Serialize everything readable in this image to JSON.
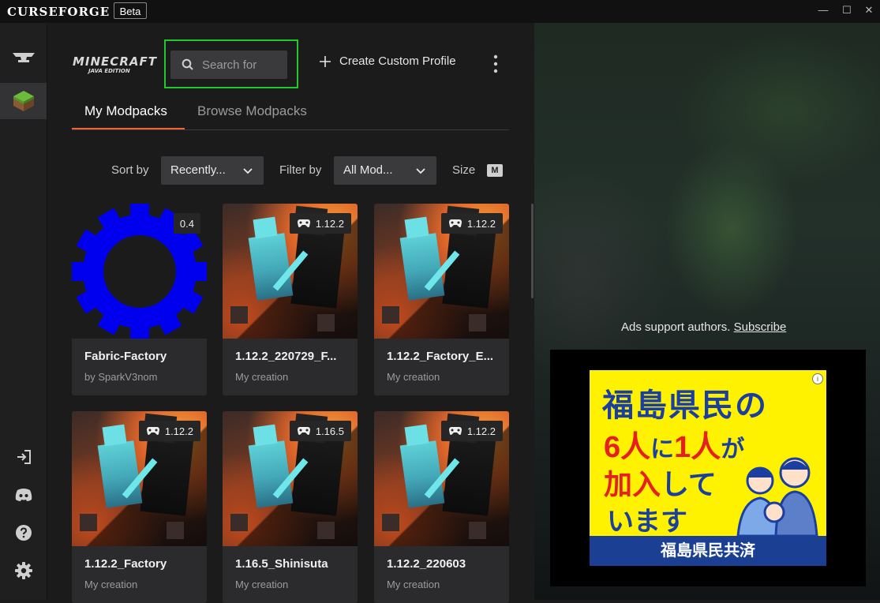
{
  "app": {
    "logo": "CURSEFORGE",
    "beta_label": "Beta"
  },
  "window": {
    "minimize": "—",
    "maximize": "☐",
    "close": "✕"
  },
  "rail": {
    "anvil": "anvil-icon",
    "minecraft": "minecraft-grass-icon",
    "login": "login-icon",
    "discord": "discord-icon",
    "help": "help-icon",
    "settings": "gear-icon"
  },
  "header": {
    "game_logo_line1": "MINECRAFT",
    "game_logo_line2": "JAVA EDITION",
    "search_placeholder": "Search for",
    "create_profile": "Create Custom Profile"
  },
  "tabs": [
    {
      "label": "My Modpacks",
      "active": true
    },
    {
      "label": "Browse Modpacks",
      "active": false
    }
  ],
  "filters": {
    "sort_label": "Sort by",
    "sort_value": "Recently...",
    "filter_label": "Filter by",
    "filter_value": "All Mod...",
    "size_label": "Size",
    "size_value": "M"
  },
  "modpacks": [
    {
      "name": "Fabric-Factory",
      "author": "by SparkV3nom",
      "badge": "0.4",
      "art": "blue-gear"
    },
    {
      "name": "1.12.2_220729_F...",
      "author": "My creation",
      "badge": "1.12.2",
      "art": "minecraft"
    },
    {
      "name": "1.12.2_Factory_E...",
      "author": "My creation",
      "badge": "1.12.2",
      "art": "minecraft"
    },
    {
      "name": "1.12.2_Factory",
      "author": "My creation",
      "badge": "1.12.2",
      "art": "minecraft"
    },
    {
      "name": "1.16.5_Shinisuta",
      "author": "My creation",
      "badge": "1.16.5",
      "art": "minecraft"
    },
    {
      "name": "1.12.2_220603",
      "author": "My creation",
      "badge": "1.12.2",
      "art": "minecraft"
    }
  ],
  "ads": {
    "support_text": "Ads support authors.",
    "subscribe_link": "Subscribe",
    "ad_line1": "福島県民の",
    "ad_line2_a": "6",
    "ad_line2_b": "人",
    "ad_line2_c": "に",
    "ad_line2_d": "1",
    "ad_line2_e": "人",
    "ad_line2_f": "が",
    "ad_line3_a": "加入",
    "ad_line3_b": "して",
    "ad_line4": "います",
    "ad_footer": "福島県民共済"
  },
  "colors": {
    "accent": "#f16436",
    "focus": "#23c82e",
    "ad_yellow": "#fff200",
    "ad_blue": "#1a3fa0"
  }
}
